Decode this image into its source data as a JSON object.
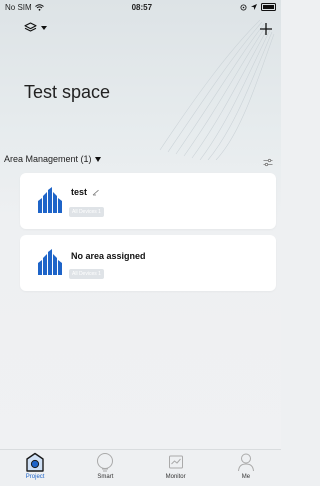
{
  "status_bar": {
    "carrier": "No SIM",
    "time": "08:57"
  },
  "space": {
    "title": "Test space"
  },
  "area_management": {
    "label": "Area Management (1)"
  },
  "areas": [
    {
      "name": "test",
      "chip": "All Devices 1"
    },
    {
      "name": "No area assigned",
      "chip": "All Devices 1"
    }
  ],
  "tabs": [
    {
      "label": "Project",
      "active": true
    },
    {
      "label": "Smart",
      "active": false
    },
    {
      "label": "Monitor",
      "active": false
    },
    {
      "label": "Me",
      "active": false
    }
  ],
  "colors": {
    "accent": "#1e64c8",
    "background": "#eef0f2",
    "card": "#ffffff"
  }
}
